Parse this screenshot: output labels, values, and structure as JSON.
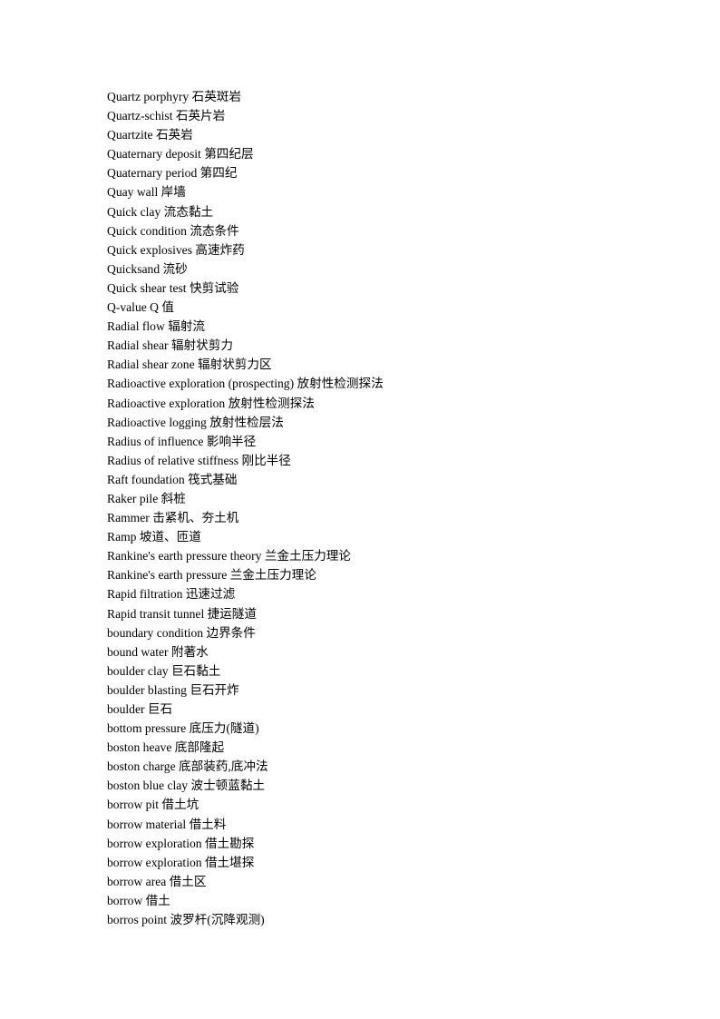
{
  "document": {
    "page_background": "#ffffff",
    "text_color": "#000000",
    "glossary": {
      "entries": [
        "Quartz porphyry 石英斑岩",
        "Quartz-schist 石英片岩",
        "Quartzite 石英岩",
        "Quaternary deposit 第四纪层",
        "Quaternary period 第四纪",
        "Quay wall 岸墙",
        "Quick clay 流态黏土",
        "Quick condition 流态条件",
        "Quick explosives 高速炸药",
        "Quicksand 流砂",
        "Quick shear test 快剪试验",
        "Q-value Q 值",
        "Radial flow 辐射流",
        "Radial shear 辐射状剪力",
        "Radial shear zone 辐射状剪力区",
        "Radioactive exploration (prospecting) 放射性检测探法",
        "Radioactive exploration 放射性检测探法",
        "Radioactive logging 放射性检层法",
        "Radius of influence 影响半径",
        "Radius of relative stiffness 刚比半径",
        "Raft foundation 筏式基础",
        "Raker pile 斜桩",
        "Rammer 击紧机、夯土机",
        "Ramp 坡道、匝道",
        "Rankine's earth pressure theory 兰金土压力理论",
        "Rankine's earth pressure 兰金土压力理论",
        "Rapid filtration 迅速过滤",
        "Rapid transit tunnel 捷运隧道",
        "boundary condition 边界条件",
        "bound water 附著水",
        "boulder clay 巨石黏土",
        "boulder blasting 巨石开炸",
        "boulder 巨石",
        "bottom pressure 底压力(隧道)",
        "boston heave 底部隆起",
        "boston charge 底部装药,底冲法",
        "boston blue clay 波士顿蓝黏土",
        "borrow pit 借土坑",
        "borrow material 借土料",
        "borrow exploration 借土勘探",
        "borrow exploration 借土堪探",
        "borrow area 借土区",
        "borrow 借土",
        "borros point 波罗杆(沉降观测)"
      ]
    }
  }
}
